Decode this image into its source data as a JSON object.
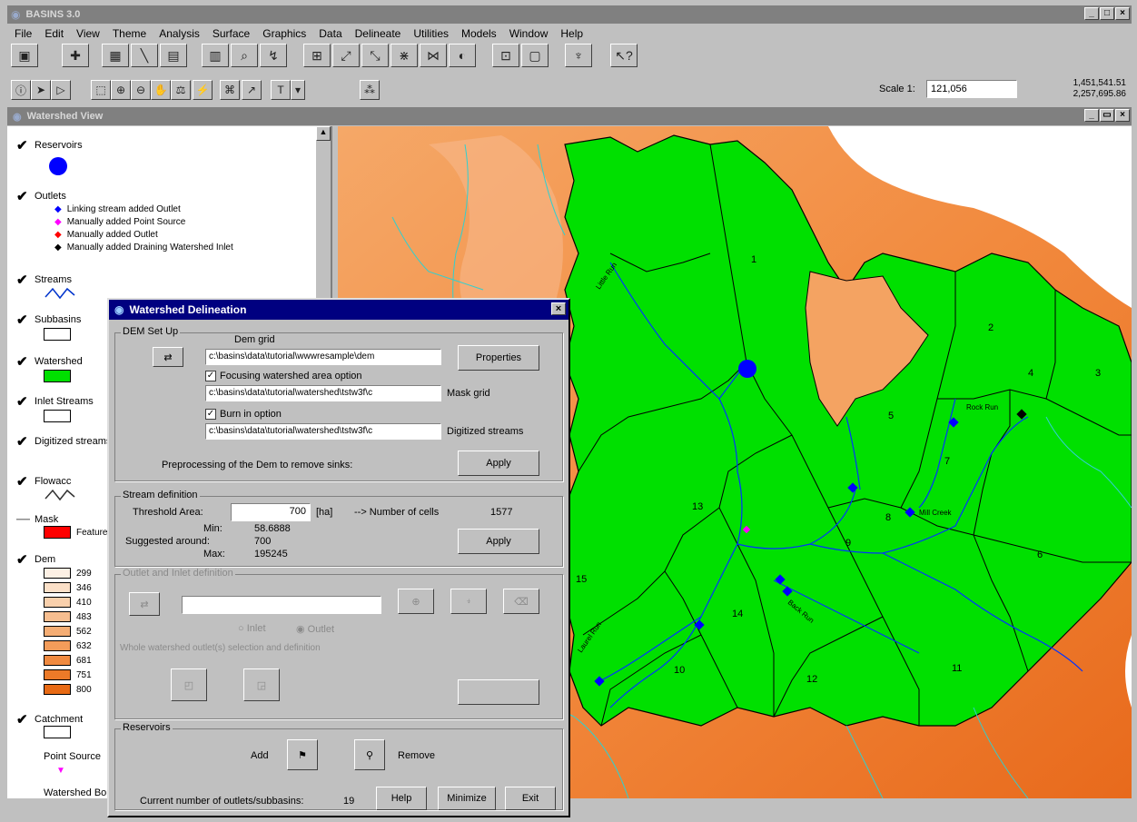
{
  "app": {
    "title": "BASINS 3.0"
  },
  "menu": [
    "File",
    "Edit",
    "View",
    "Theme",
    "Analysis",
    "Surface",
    "Graphics",
    "Data",
    "Delineate",
    "Utilities",
    "Models",
    "Window",
    "Help"
  ],
  "toolbar2": {
    "scale_label": "Scale 1:",
    "scale_value": "121,056",
    "coord_x": "1,451,541.51",
    "coord_y": "2,257,695.86"
  },
  "view": {
    "title": "Watershed View"
  },
  "legend": {
    "reservoirs": "Reservoirs",
    "outlets": "Outlets",
    "outlet_items": [
      "Linking stream added Outlet",
      "Manually added Point Source",
      "Manually added Outlet",
      "Manually added Draining Watershed Inlet"
    ],
    "streams": "Streams",
    "subbasins": "Subbasins",
    "watershed": "Watershed",
    "inlet_streams": "Inlet Streams",
    "digitized": "Digitized streams",
    "flowacc": "Flowacc",
    "mask": "Mask",
    "mask_item": "Feature",
    "dem": "Dem",
    "dem_values": [
      "299",
      "346",
      "410",
      "483",
      "562",
      "632",
      "681",
      "751",
      "800"
    ],
    "catchment": "Catchment",
    "point_source": "Point Source",
    "watershed_boundary": "Watershed Boundary"
  },
  "map_labels": {
    "subbasins": [
      "1",
      "2",
      "3",
      "4",
      "5",
      "6",
      "7",
      "8",
      "9",
      "10",
      "11",
      "12",
      "13",
      "14",
      "15"
    ],
    "streams": [
      "Little Run",
      "Rock Run",
      "Mill Creek",
      "Back Run",
      "Laurel Run"
    ]
  },
  "dialog": {
    "title": "Watershed Delineation",
    "dem_setup": "DEM Set Up",
    "dem_grid_label": "Dem grid",
    "dem_grid_value": "c:\\basins\\data\\tutorial\\wwwresample\\dem",
    "properties": "Properties",
    "focusing_label": "Focusing watershed area option",
    "mask_value": "c:\\basins\\data\\tutorial\\watershed\\tstw3f\\c",
    "mask_label": "Mask grid",
    "burnin_label": "Burn in option",
    "burn_value": "c:\\basins\\data\\tutorial\\watershed\\tstw3f\\c",
    "digitized_label": "Digitized streams",
    "preprocess_label": "Preprocessing of the Dem to remove sinks:",
    "apply": "Apply",
    "stream_def": "Stream definition",
    "threshold_label": "Threshold Area:",
    "threshold_value": "700",
    "threshold_unit": "[ha]",
    "cells_label": "--> Number of cells",
    "cells_value": "1577",
    "min_label": "Min:",
    "min_value": "58.6888",
    "suggested_label": "Suggested around:",
    "suggested_value": "700",
    "max_label": "Max:",
    "max_value": "195245",
    "outlet_def": "Outlet and Inlet definition",
    "radio_inlet": "Inlet",
    "radio_outlet": "Outlet",
    "select_label": "Whole watershed outlet(s) selection and definition",
    "reservoirs": "Reservoirs",
    "add": "Add",
    "remove": "Remove",
    "count_label": "Current number of outlets/subbasins:",
    "count_value": "19",
    "help": "Help",
    "minimize": "Minimize",
    "exit": "Exit"
  },
  "colors": {
    "title_active": "#000080",
    "watershed": "#00e000",
    "dem_low": "#fbe3cc",
    "dem_high": "#f07820"
  }
}
